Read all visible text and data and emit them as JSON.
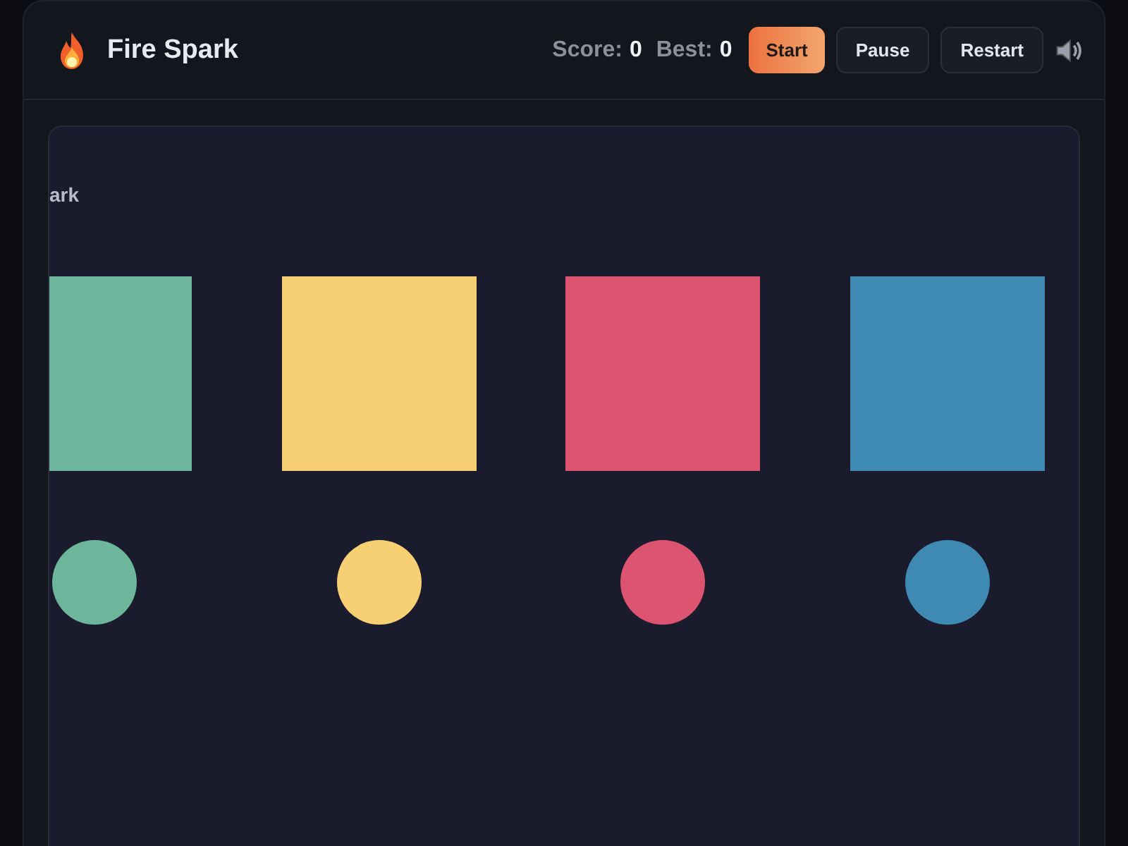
{
  "header": {
    "title": "Fire Spark",
    "score_label": "Score:",
    "score": "0",
    "best_label": "Best:",
    "best": "0",
    "buttons": [
      {
        "label": "Start",
        "kind": "primary"
      },
      {
        "label": "Pause",
        "kind": "secondary"
      },
      {
        "label": "Restart",
        "kind": "secondary"
      }
    ]
  },
  "board": {
    "caption": "ark",
    "pads": [
      {
        "color": "#6db59b"
      },
      {
        "color": "#f7d074"
      },
      {
        "color": "#dd5470"
      },
      {
        "color": "#3f8ab3"
      }
    ]
  }
}
